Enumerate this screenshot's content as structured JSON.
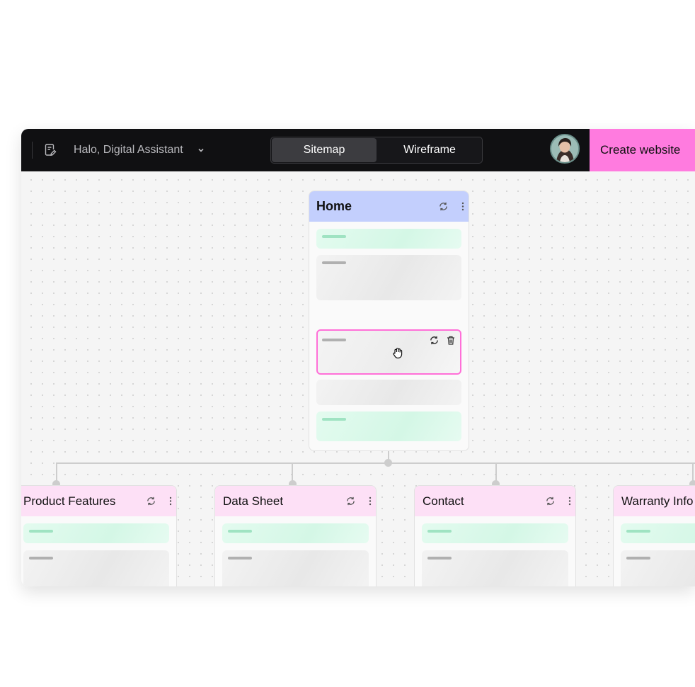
{
  "topbar": {
    "project_name": "Halo, Digital Assistant",
    "view_tabs": [
      {
        "label": "Sitemap",
        "active": true
      },
      {
        "label": "Wireframe",
        "active": false
      }
    ],
    "cta_label": "Create website",
    "accent_color": "#ff7bdf"
  },
  "sitemap": {
    "home": {
      "title": "Home",
      "sections": [
        "green",
        "grey",
        "selected",
        "grey",
        "green"
      ]
    },
    "pages": [
      {
        "title": "Product Features"
      },
      {
        "title": "Data Sheet"
      },
      {
        "title": "Contact"
      },
      {
        "title": "Warranty Info"
      }
    ]
  },
  "icons": [
    "document-edit-icon",
    "chevron-down-icon",
    "refresh-icon",
    "more-vertical-icon",
    "trash-icon",
    "grab-hand-icon"
  ]
}
